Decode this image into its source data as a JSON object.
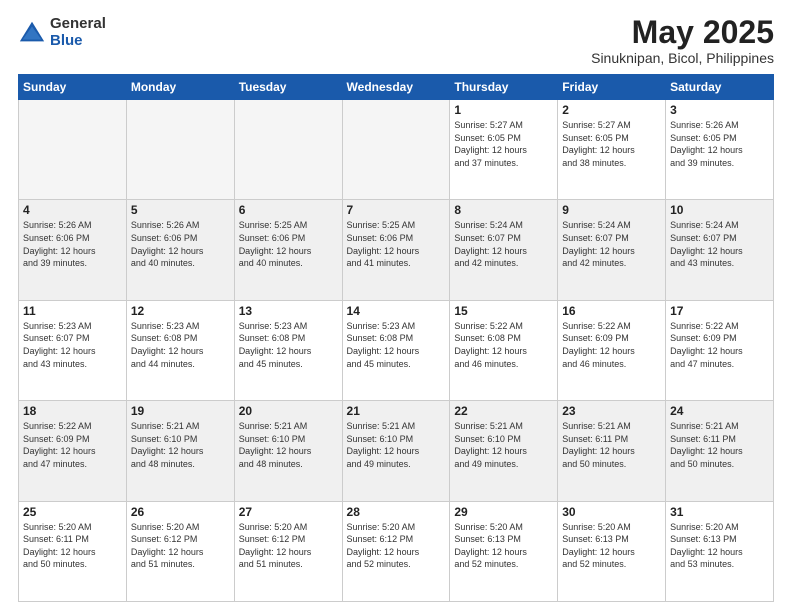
{
  "header": {
    "logo_general": "General",
    "logo_blue": "Blue",
    "title": "May 2025",
    "location": "Sinuknipan, Bicol, Philippines"
  },
  "weekdays": [
    "Sunday",
    "Monday",
    "Tuesday",
    "Wednesday",
    "Thursday",
    "Friday",
    "Saturday"
  ],
  "weeks": [
    [
      {
        "day": "",
        "info": ""
      },
      {
        "day": "",
        "info": ""
      },
      {
        "day": "",
        "info": ""
      },
      {
        "day": "",
        "info": ""
      },
      {
        "day": "1",
        "info": "Sunrise: 5:27 AM\nSunset: 6:05 PM\nDaylight: 12 hours\nand 37 minutes."
      },
      {
        "day": "2",
        "info": "Sunrise: 5:27 AM\nSunset: 6:05 PM\nDaylight: 12 hours\nand 38 minutes."
      },
      {
        "day": "3",
        "info": "Sunrise: 5:26 AM\nSunset: 6:05 PM\nDaylight: 12 hours\nand 39 minutes."
      }
    ],
    [
      {
        "day": "4",
        "info": "Sunrise: 5:26 AM\nSunset: 6:06 PM\nDaylight: 12 hours\nand 39 minutes."
      },
      {
        "day": "5",
        "info": "Sunrise: 5:26 AM\nSunset: 6:06 PM\nDaylight: 12 hours\nand 40 minutes."
      },
      {
        "day": "6",
        "info": "Sunrise: 5:25 AM\nSunset: 6:06 PM\nDaylight: 12 hours\nand 40 minutes."
      },
      {
        "day": "7",
        "info": "Sunrise: 5:25 AM\nSunset: 6:06 PM\nDaylight: 12 hours\nand 41 minutes."
      },
      {
        "day": "8",
        "info": "Sunrise: 5:24 AM\nSunset: 6:07 PM\nDaylight: 12 hours\nand 42 minutes."
      },
      {
        "day": "9",
        "info": "Sunrise: 5:24 AM\nSunset: 6:07 PM\nDaylight: 12 hours\nand 42 minutes."
      },
      {
        "day": "10",
        "info": "Sunrise: 5:24 AM\nSunset: 6:07 PM\nDaylight: 12 hours\nand 43 minutes."
      }
    ],
    [
      {
        "day": "11",
        "info": "Sunrise: 5:23 AM\nSunset: 6:07 PM\nDaylight: 12 hours\nand 43 minutes."
      },
      {
        "day": "12",
        "info": "Sunrise: 5:23 AM\nSunset: 6:08 PM\nDaylight: 12 hours\nand 44 minutes."
      },
      {
        "day": "13",
        "info": "Sunrise: 5:23 AM\nSunset: 6:08 PM\nDaylight: 12 hours\nand 45 minutes."
      },
      {
        "day": "14",
        "info": "Sunrise: 5:23 AM\nSunset: 6:08 PM\nDaylight: 12 hours\nand 45 minutes."
      },
      {
        "day": "15",
        "info": "Sunrise: 5:22 AM\nSunset: 6:08 PM\nDaylight: 12 hours\nand 46 minutes."
      },
      {
        "day": "16",
        "info": "Sunrise: 5:22 AM\nSunset: 6:09 PM\nDaylight: 12 hours\nand 46 minutes."
      },
      {
        "day": "17",
        "info": "Sunrise: 5:22 AM\nSunset: 6:09 PM\nDaylight: 12 hours\nand 47 minutes."
      }
    ],
    [
      {
        "day": "18",
        "info": "Sunrise: 5:22 AM\nSunset: 6:09 PM\nDaylight: 12 hours\nand 47 minutes."
      },
      {
        "day": "19",
        "info": "Sunrise: 5:21 AM\nSunset: 6:10 PM\nDaylight: 12 hours\nand 48 minutes."
      },
      {
        "day": "20",
        "info": "Sunrise: 5:21 AM\nSunset: 6:10 PM\nDaylight: 12 hours\nand 48 minutes."
      },
      {
        "day": "21",
        "info": "Sunrise: 5:21 AM\nSunset: 6:10 PM\nDaylight: 12 hours\nand 49 minutes."
      },
      {
        "day": "22",
        "info": "Sunrise: 5:21 AM\nSunset: 6:10 PM\nDaylight: 12 hours\nand 49 minutes."
      },
      {
        "day": "23",
        "info": "Sunrise: 5:21 AM\nSunset: 6:11 PM\nDaylight: 12 hours\nand 50 minutes."
      },
      {
        "day": "24",
        "info": "Sunrise: 5:21 AM\nSunset: 6:11 PM\nDaylight: 12 hours\nand 50 minutes."
      }
    ],
    [
      {
        "day": "25",
        "info": "Sunrise: 5:20 AM\nSunset: 6:11 PM\nDaylight: 12 hours\nand 50 minutes."
      },
      {
        "day": "26",
        "info": "Sunrise: 5:20 AM\nSunset: 6:12 PM\nDaylight: 12 hours\nand 51 minutes."
      },
      {
        "day": "27",
        "info": "Sunrise: 5:20 AM\nSunset: 6:12 PM\nDaylight: 12 hours\nand 51 minutes."
      },
      {
        "day": "28",
        "info": "Sunrise: 5:20 AM\nSunset: 6:12 PM\nDaylight: 12 hours\nand 52 minutes."
      },
      {
        "day": "29",
        "info": "Sunrise: 5:20 AM\nSunset: 6:13 PM\nDaylight: 12 hours\nand 52 minutes."
      },
      {
        "day": "30",
        "info": "Sunrise: 5:20 AM\nSunset: 6:13 PM\nDaylight: 12 hours\nand 52 minutes."
      },
      {
        "day": "31",
        "info": "Sunrise: 5:20 AM\nSunset: 6:13 PM\nDaylight: 12 hours\nand 53 minutes."
      }
    ]
  ]
}
